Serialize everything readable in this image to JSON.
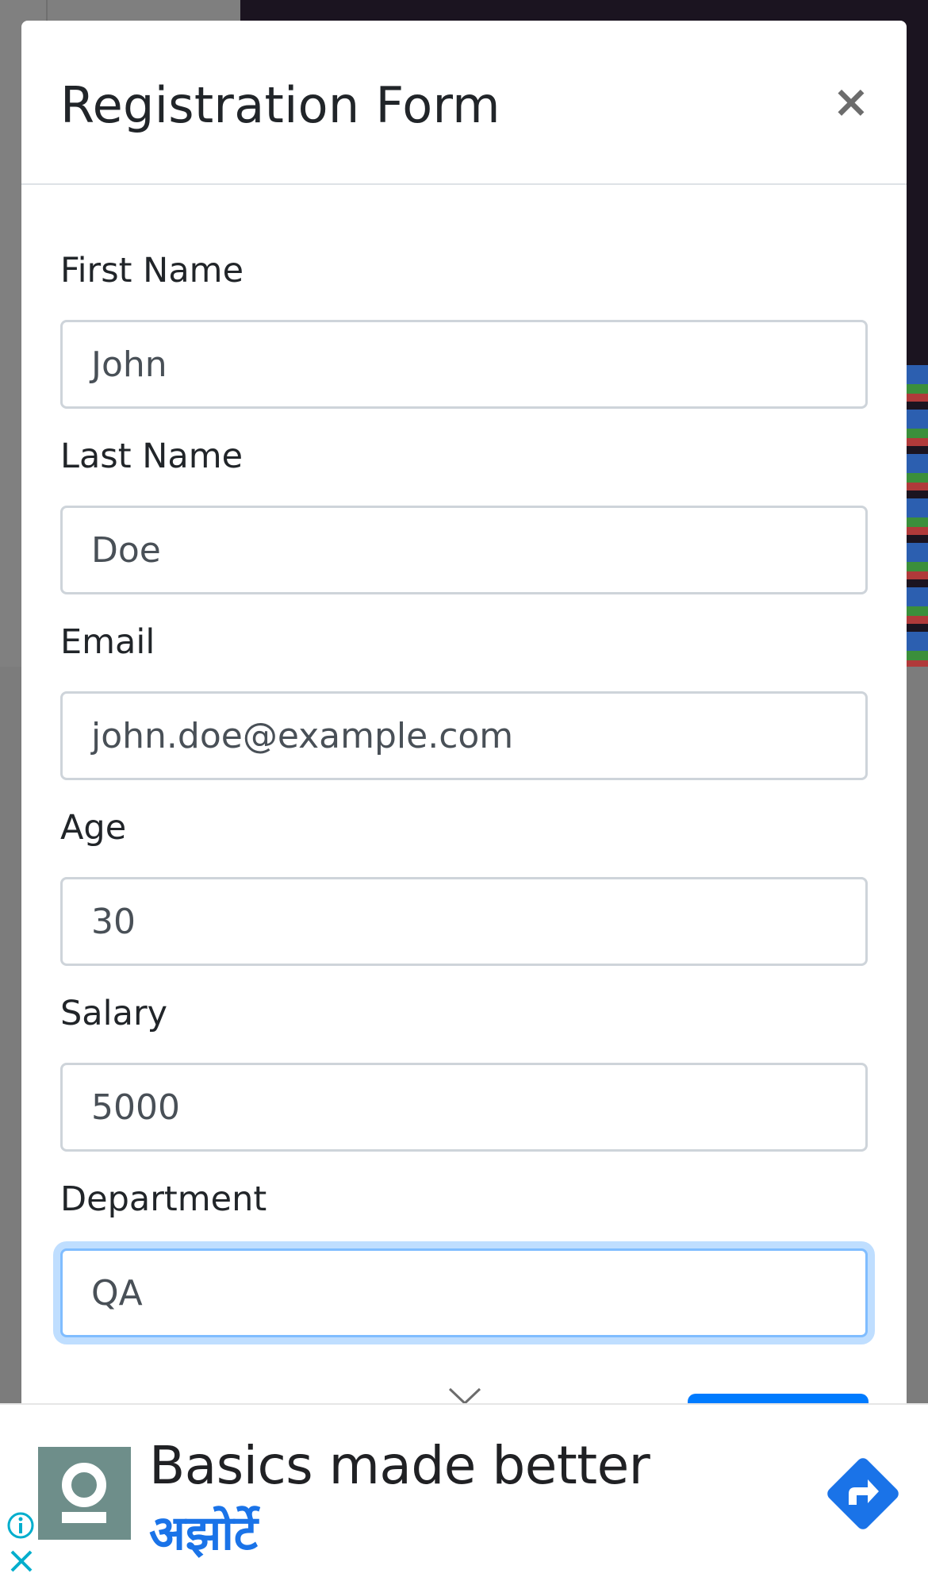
{
  "modal": {
    "title": "Registration Form",
    "close_label": "×"
  },
  "fields": [
    {
      "label": "First Name",
      "value": "John"
    },
    {
      "label": "Last Name",
      "value": "Doe"
    },
    {
      "label": "Email",
      "value": "john.doe@example.com"
    },
    {
      "label": "Age",
      "value": "30"
    },
    {
      "label": "Salary",
      "value": "5000"
    },
    {
      "label": "Department",
      "value": "QA"
    }
  ],
  "ad": {
    "headline": "Basics made better",
    "brand": "अझोर्टे",
    "logo_icon": "person-icon",
    "action_icon": "directions-arrow-icon",
    "colors": {
      "brand": "#1a73e8",
      "logo_bg": "#6e8e8a"
    }
  },
  "colors": {
    "accent": "#007bff",
    "focus_ring": "#80bdff"
  }
}
